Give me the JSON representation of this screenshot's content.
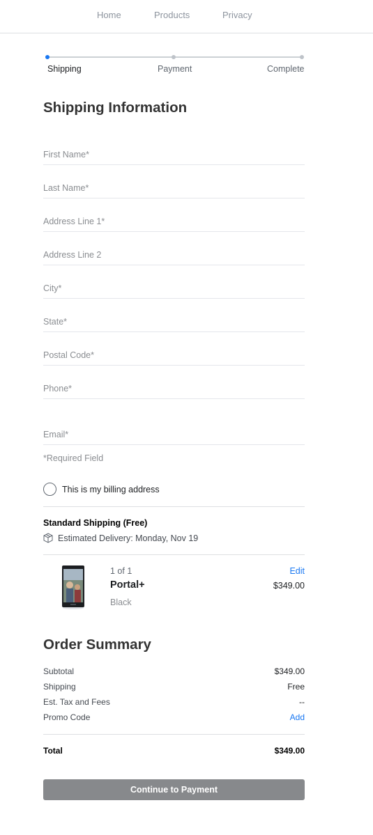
{
  "nav": {
    "home": "Home",
    "products": "Products",
    "privacy": "Privacy"
  },
  "steps": [
    {
      "label": "Shipping",
      "active": true
    },
    {
      "label": "Payment",
      "active": false
    },
    {
      "label": "Complete",
      "active": false
    }
  ],
  "title": "Shipping Information",
  "fields": {
    "first_name": {
      "placeholder": "First Name*",
      "value": ""
    },
    "last_name": {
      "placeholder": "Last Name*",
      "value": ""
    },
    "address1": {
      "placeholder": "Address Line 1*",
      "value": ""
    },
    "address2": {
      "placeholder": "Address Line 2",
      "value": ""
    },
    "city": {
      "placeholder": "City*",
      "value": ""
    },
    "state": {
      "placeholder": "State*",
      "value": ""
    },
    "postal": {
      "placeholder": "Postal Code*",
      "value": ""
    },
    "phone": {
      "placeholder": "Phone*",
      "value": ""
    },
    "email": {
      "placeholder": "Email*",
      "value": ""
    }
  },
  "required_note": "*Required Field",
  "billing_checkbox": {
    "label": "This is my billing address",
    "checked": false
  },
  "shipping": {
    "method": "Standard Shipping (Free)",
    "delivery": "Estimated Delivery: Monday, Nov 19",
    "icon": "box-icon"
  },
  "product": {
    "count": "1 of 1",
    "name": "Portal+",
    "variant": "Black",
    "price": "$349.00",
    "edit_label": "Edit",
    "image_icon": "portal-device-image"
  },
  "summary": {
    "title": "Order Summary",
    "rows": [
      {
        "label": "Subtotal",
        "value": "$349.00"
      },
      {
        "label": "Shipping",
        "value": "Free"
      },
      {
        "label": "Est. Tax and Fees",
        "value": "--"
      },
      {
        "label": "Promo Code",
        "value": "Add"
      }
    ],
    "total_label": "Total",
    "total_value": "$349.00"
  },
  "continue_label": "Continue to Payment",
  "colors": {
    "accent": "#1877f2",
    "button_bg": "#87898c"
  }
}
